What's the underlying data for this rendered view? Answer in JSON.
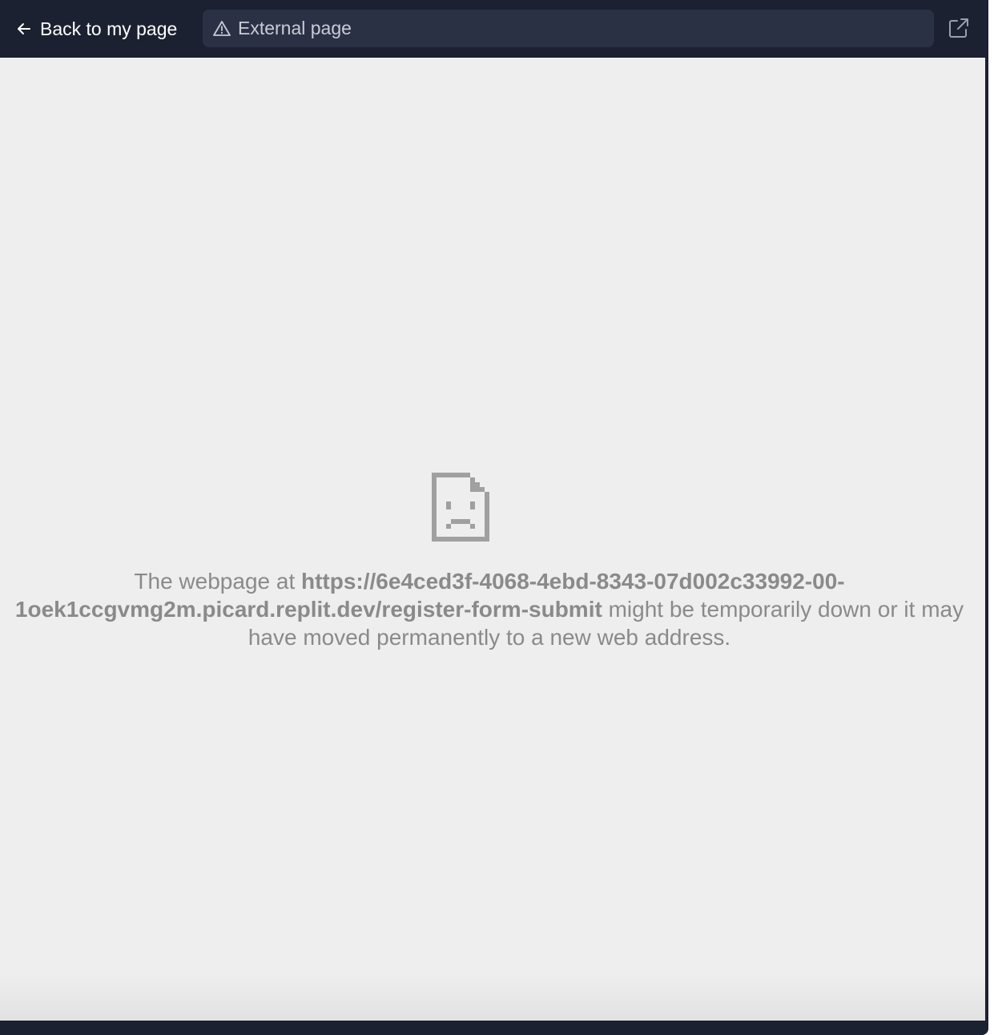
{
  "header": {
    "back_label": "Back to my page",
    "url_label": "External page",
    "icons": {
      "back": "arrow-left-icon",
      "warning": "warning-triangle-icon",
      "open_external": "external-link-icon"
    }
  },
  "error_page": {
    "icon": "sad-document-icon",
    "prefix": "The webpage at ",
    "url": "https://6e4ced3f-4068-4ebd-8343-07d002c33992-00-1oek1ccgvmg2m.picard.replit.dev/register-form-submit",
    "suffix": " might be temporarily down or it may have moved permanently to a new web address."
  },
  "colors": {
    "topbar_bg": "#1c2131",
    "urlbar_bg": "#2b3145",
    "content_bg": "#eeeeee",
    "message_text": "#8a8a8a"
  }
}
